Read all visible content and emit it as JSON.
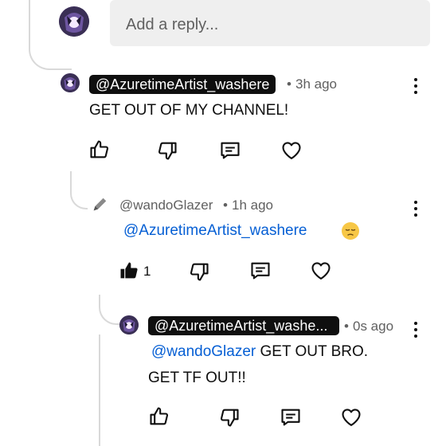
{
  "reply_box": {
    "placeholder": "Add a reply..."
  },
  "comments": [
    {
      "handle": "@AzuretimeArtist_washere",
      "time": "3h ago",
      "text": "GET OUT OF MY CHANNEL!",
      "like_count": ""
    },
    {
      "handle": "@wandoGlazer",
      "time": "1h ago",
      "mention": "@AzuretimeArtist_washere",
      "emoji": "pensive-face",
      "like_count": "1",
      "liked": true
    },
    {
      "handle": "@AzuretimeArtist_washe...",
      "time": "0s ago",
      "mention": "@wandoGlazer",
      "text_line1": " GET OUT BRO.",
      "text_line2": "GET TF OUT!!"
    }
  ],
  "separator": "•",
  "icons": [
    "avatar-icon",
    "thumbs-up-icon",
    "thumbs-down-icon",
    "reply-icon",
    "heart-icon",
    "more-vert-icon",
    "pencil-icon"
  ],
  "colors": {
    "mention": "#065fd4",
    "chip_bg": "#0f0f0f",
    "meta": "#606060",
    "reply_box_bg": "#efefef"
  }
}
